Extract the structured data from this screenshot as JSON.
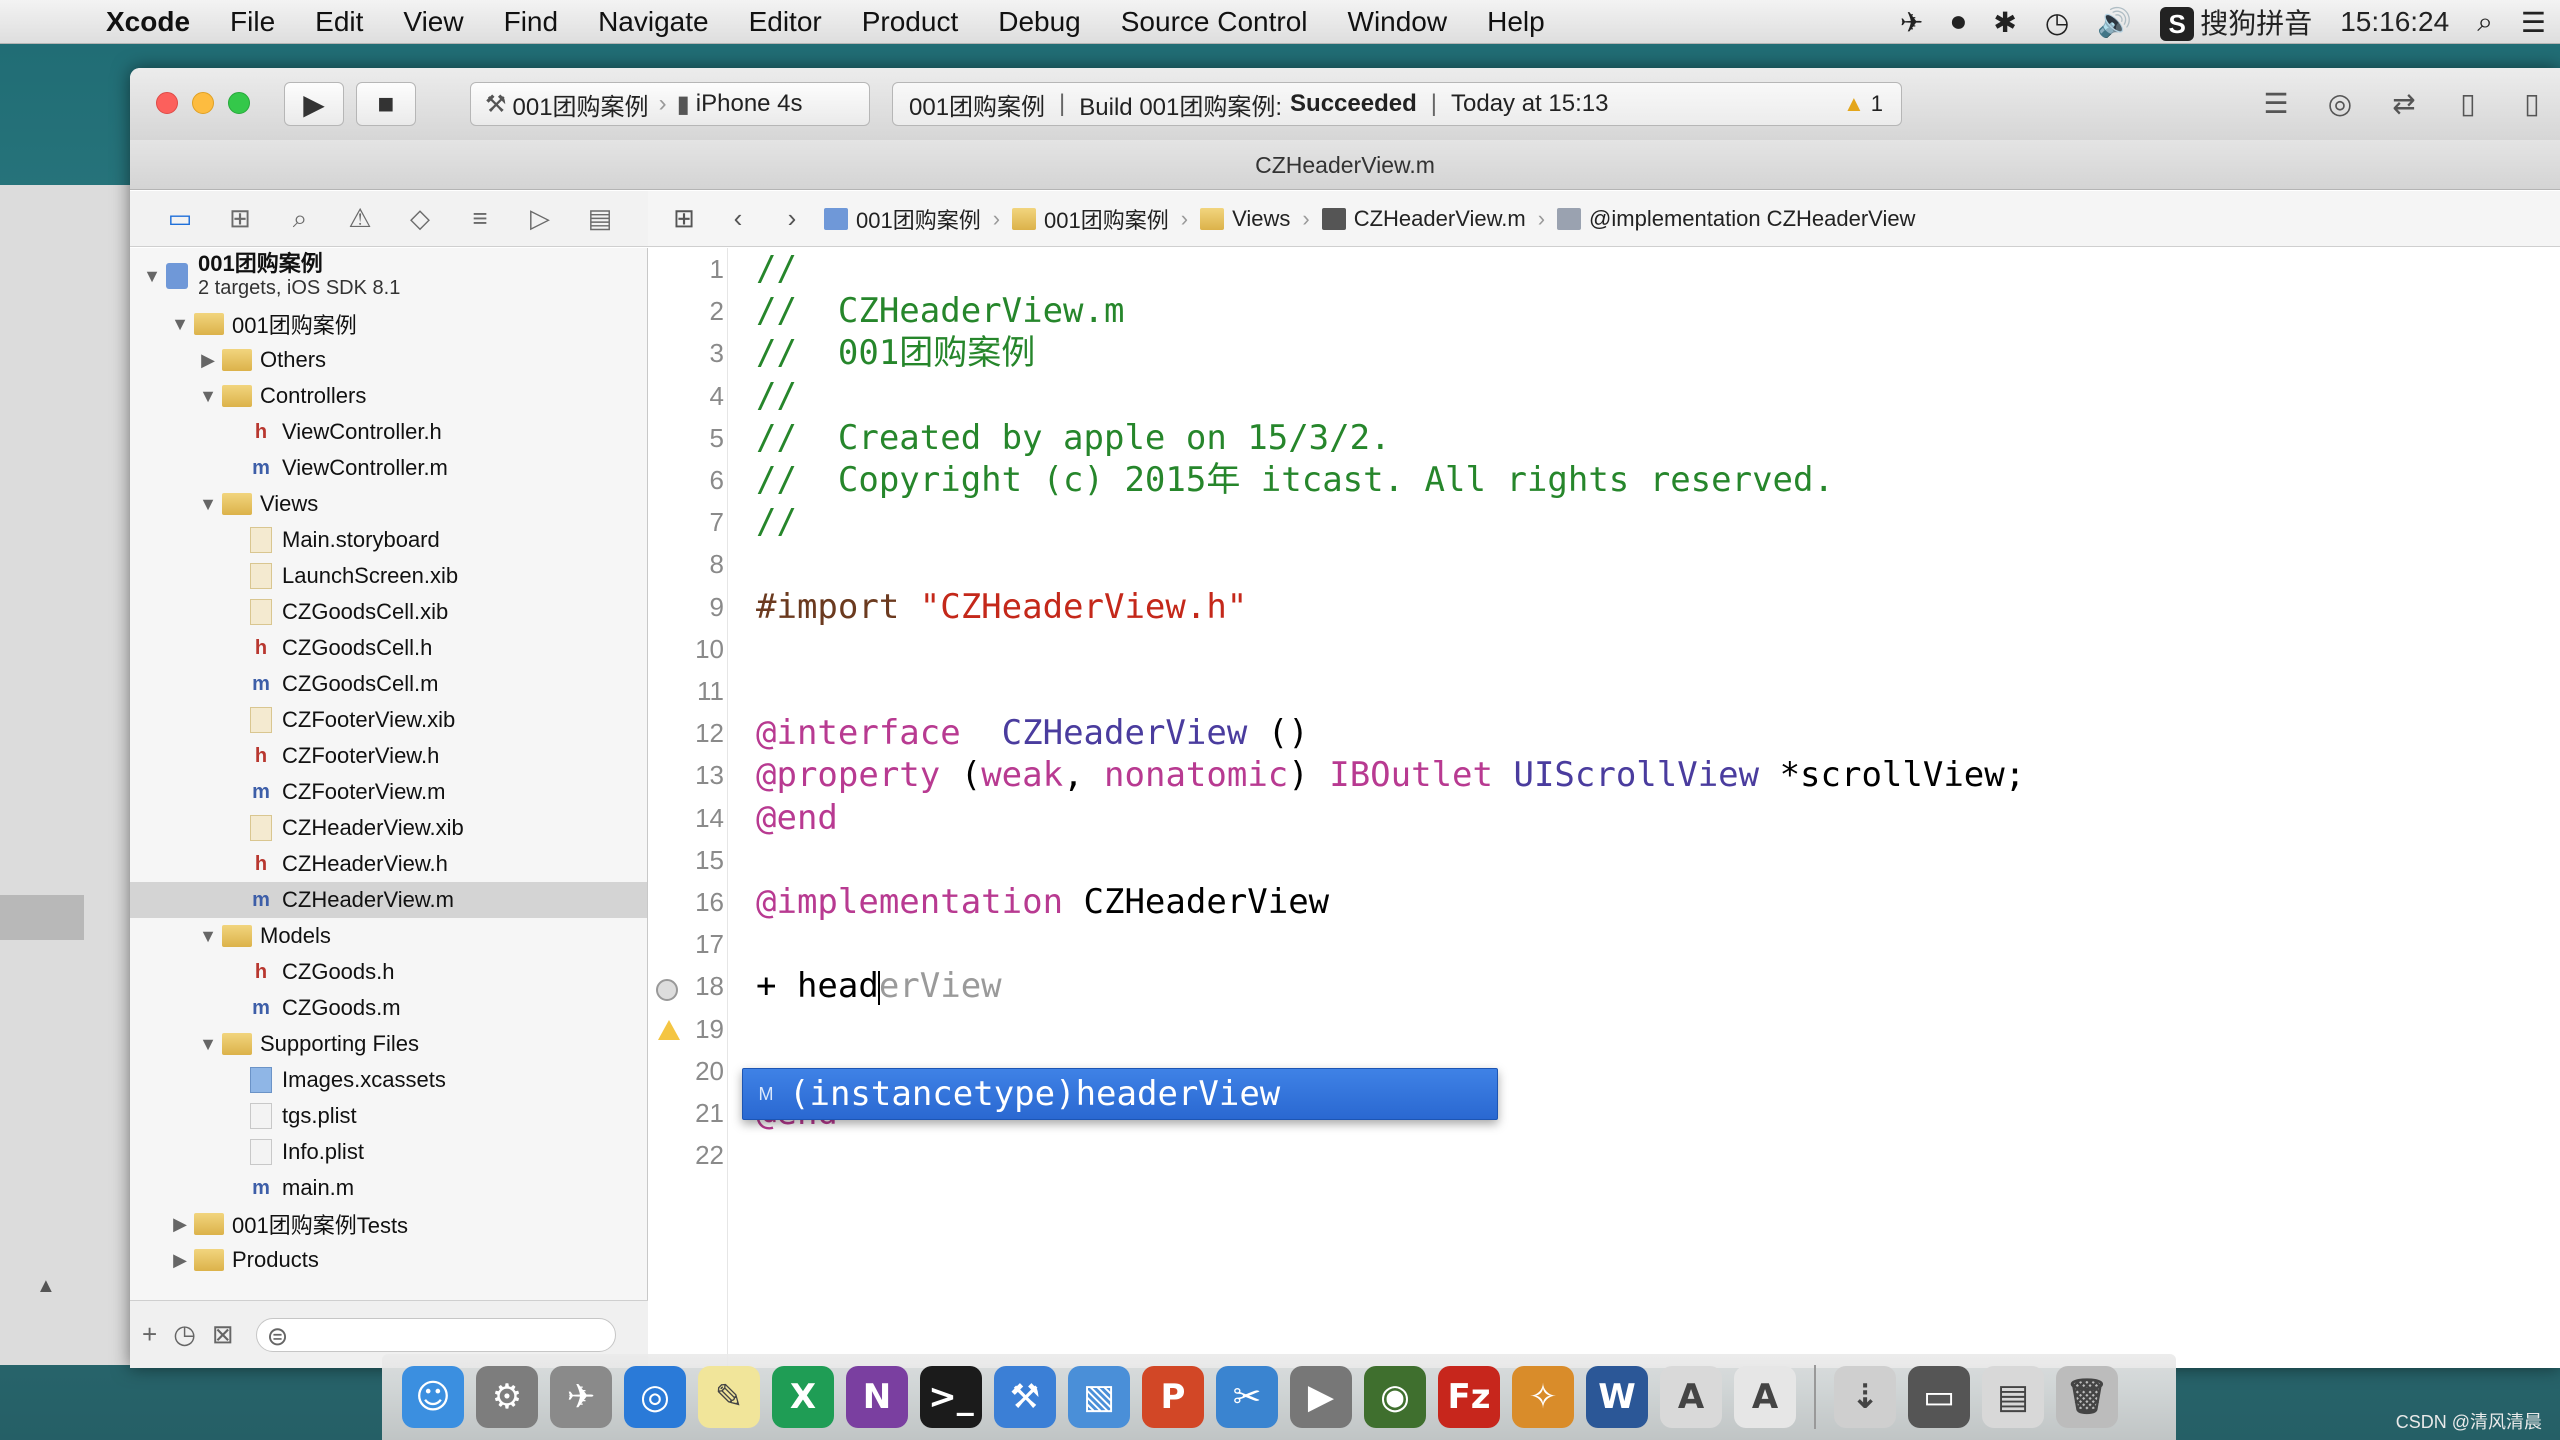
{
  "menubar": {
    "app": "Xcode",
    "items": [
      "File",
      "Edit",
      "View",
      "Find",
      "Navigate",
      "Editor",
      "Product",
      "Debug",
      "Source Control",
      "Window",
      "Help"
    ],
    "ime_label": "S",
    "ime_name": "搜狗拼音",
    "clock": "15:16:24"
  },
  "toolbar": {
    "scheme": "001团购案例",
    "device": "iPhone 4s",
    "status_project": "001团购案例",
    "status_build": "Build 001团购案例:",
    "status_result": "Succeeded",
    "status_time": "Today at 15:13",
    "warning_count": "1"
  },
  "window": {
    "title": "CZHeaderView.m"
  },
  "navigator": {
    "project_name": "001团购案例",
    "project_sub": "2 targets, iOS SDK 8.1",
    "rows": [
      {
        "label": "001团购案例",
        "indent": 1,
        "type": "folder",
        "disclosure": "open"
      },
      {
        "label": "Others",
        "indent": 2,
        "type": "folder",
        "disclosure": "closed"
      },
      {
        "label": "Controllers",
        "indent": 2,
        "type": "folder",
        "disclosure": "open"
      },
      {
        "label": "ViewController.h",
        "indent": 3,
        "type": "h"
      },
      {
        "label": "ViewController.m",
        "indent": 3,
        "type": "m"
      },
      {
        "label": "Views",
        "indent": 2,
        "type": "folder",
        "disclosure": "open"
      },
      {
        "label": "Main.storyboard",
        "indent": 3,
        "type": "doc"
      },
      {
        "label": "LaunchScreen.xib",
        "indent": 3,
        "type": "doc"
      },
      {
        "label": "CZGoodsCell.xib",
        "indent": 3,
        "type": "doc"
      },
      {
        "label": "CZGoodsCell.h",
        "indent": 3,
        "type": "h"
      },
      {
        "label": "CZGoodsCell.m",
        "indent": 3,
        "type": "m"
      },
      {
        "label": "CZFooterView.xib",
        "indent": 3,
        "type": "doc"
      },
      {
        "label": "CZFooterView.h",
        "indent": 3,
        "type": "h"
      },
      {
        "label": "CZFooterView.m",
        "indent": 3,
        "type": "m"
      },
      {
        "label": "CZHeaderView.xib",
        "indent": 3,
        "type": "doc"
      },
      {
        "label": "CZHeaderView.h",
        "indent": 3,
        "type": "h"
      },
      {
        "label": "CZHeaderView.m",
        "indent": 3,
        "type": "m",
        "selected": true
      },
      {
        "label": "Models",
        "indent": 2,
        "type": "folder",
        "disclosure": "open"
      },
      {
        "label": "CZGoods.h",
        "indent": 3,
        "type": "h"
      },
      {
        "label": "CZGoods.m",
        "indent": 3,
        "type": "m"
      },
      {
        "label": "Supporting Files",
        "indent": 2,
        "type": "folder",
        "disclosure": "open"
      },
      {
        "label": "Images.xcassets",
        "indent": 3,
        "type": "asset"
      },
      {
        "label": "tgs.plist",
        "indent": 3,
        "type": "plist"
      },
      {
        "label": "Info.plist",
        "indent": 3,
        "type": "plist"
      },
      {
        "label": "main.m",
        "indent": 3,
        "type": "m"
      },
      {
        "label": "001团购案例Tests",
        "indent": 1,
        "type": "folder",
        "disclosure": "closed"
      },
      {
        "label": "Products",
        "indent": 1,
        "type": "folder",
        "disclosure": "closed"
      }
    ]
  },
  "jumpbar": {
    "crumbs": [
      {
        "label": "001团购案例",
        "icon": "proj"
      },
      {
        "label": "001团购案例",
        "icon": "fold"
      },
      {
        "label": "Views",
        "icon": "fold"
      },
      {
        "label": "CZHeaderView.m",
        "icon": "m"
      },
      {
        "label": "@implementation CZHeaderView",
        "icon": "c"
      }
    ]
  },
  "editor": {
    "lines": [
      {
        "n": "1",
        "segs": [
          [
            "c-com",
            "//"
          ]
        ]
      },
      {
        "n": "2",
        "segs": [
          [
            "c-com",
            "//  CZHeaderView.m"
          ]
        ]
      },
      {
        "n": "3",
        "segs": [
          [
            "c-com",
            "//  001团购案例"
          ]
        ]
      },
      {
        "n": "4",
        "segs": [
          [
            "c-com",
            "//"
          ]
        ]
      },
      {
        "n": "5",
        "segs": [
          [
            "c-com",
            "//  Created by apple on 15/3/2."
          ]
        ]
      },
      {
        "n": "6",
        "segs": [
          [
            "c-com",
            "//  Copyright (c) 2015年 itcast. All rights reserved."
          ]
        ]
      },
      {
        "n": "7",
        "segs": [
          [
            "c-com",
            "//"
          ]
        ]
      },
      {
        "n": "8",
        "segs": []
      },
      {
        "n": "9",
        "segs": [
          [
            "c-pp",
            "#import "
          ],
          [
            "c-str",
            "\"CZHeaderView.h\""
          ]
        ]
      },
      {
        "n": "10",
        "segs": []
      },
      {
        "n": "11",
        "segs": []
      },
      {
        "n": "12",
        "segs": [
          [
            "c-kw",
            "@interface"
          ],
          [
            "",
            "  "
          ],
          [
            "c-cls",
            "CZHeaderView"
          ],
          [
            "",
            " ()"
          ]
        ]
      },
      {
        "n": "13",
        "segs": [
          [
            "c-kw",
            "@property"
          ],
          [
            "",
            " ("
          ],
          [
            "c-kw",
            "weak"
          ],
          [
            "",
            ", "
          ],
          [
            "c-kw",
            "nonatomic"
          ],
          [
            "",
            ") "
          ],
          [
            "c-kw",
            "IBOutlet"
          ],
          [
            "",
            " "
          ],
          [
            "c-cls",
            "UIScrollView"
          ],
          [
            "",
            " *scrollView;"
          ]
        ]
      },
      {
        "n": "14",
        "segs": [
          [
            "c-kw",
            "@end"
          ]
        ]
      },
      {
        "n": "15",
        "segs": []
      },
      {
        "n": "16",
        "segs": [
          [
            "c-kw",
            "@implementation"
          ],
          [
            "",
            " CZHeaderView"
          ]
        ]
      },
      {
        "n": "17",
        "segs": []
      },
      {
        "n": "18",
        "segs": [
          [
            "",
            "+ head"
          ],
          [
            "caret",
            ""
          ],
          [
            "c-ghost",
            "erView"
          ]
        ]
      },
      {
        "n": "19",
        "segs": []
      },
      {
        "n": "20",
        "segs": []
      },
      {
        "n": "21",
        "segs": [
          [
            "c-kw",
            "@end"
          ]
        ]
      },
      {
        "n": "22",
        "segs": []
      }
    ],
    "completion": {
      "kind": "M",
      "text": "(instancetype)headerView"
    }
  },
  "dock": {
    "apps": [
      {
        "name": "finder",
        "glyph": "☺",
        "color": "#3b8fe0"
      },
      {
        "name": "system-preferences",
        "glyph": "⚙",
        "color": "#7d7d7d"
      },
      {
        "name": "launchpad",
        "glyph": "✈",
        "color": "#8a8a8a"
      },
      {
        "name": "safari",
        "glyph": "◎",
        "color": "#2a7ad8"
      },
      {
        "name": "notes",
        "glyph": "✎",
        "color": "#f1e59a"
      },
      {
        "name": "excel",
        "glyph": "X",
        "color": "#1f9d55"
      },
      {
        "name": "onenote",
        "glyph": "N",
        "color": "#7a3fa0"
      },
      {
        "name": "terminal",
        "glyph": ">_",
        "color": "#1b1b1b"
      },
      {
        "name": "xcode",
        "glyph": "⚒",
        "color": "#3b7fd6"
      },
      {
        "name": "preview",
        "glyph": "▧",
        "color": "#4a8fd8"
      },
      {
        "name": "powerpoint",
        "glyph": "P",
        "color": "#d24726"
      },
      {
        "name": "tool-scissors",
        "glyph": "✂",
        "color": "#3a84d0"
      },
      {
        "name": "media-clapper",
        "glyph": "▶",
        "color": "#777777"
      },
      {
        "name": "globe-app",
        "glyph": "◉",
        "color": "#3f6f2e"
      },
      {
        "name": "filezilla",
        "glyph": "Fz",
        "color": "#c7261c"
      },
      {
        "name": "brush-app",
        "glyph": "✧",
        "color": "#d98c2a"
      },
      {
        "name": "word",
        "glyph": "W",
        "color": "#2b5797"
      },
      {
        "name": "script-editor",
        "glyph": "A",
        "color": "#d9d9d9"
      },
      {
        "name": "text-editor",
        "glyph": "A",
        "color": "#e6e6e6"
      }
    ],
    "extras": [
      {
        "name": "downloads-stack",
        "glyph": "⇣",
        "color": "#cfcfcf"
      },
      {
        "name": "desktop-stack",
        "glyph": "▭",
        "color": "#555555"
      },
      {
        "name": "documents-stack",
        "glyph": "▤",
        "color": "#d8d8d8"
      },
      {
        "name": "trash",
        "glyph": "🗑",
        "color": "#bcbcbc"
      }
    ]
  },
  "watermark": "CSDN @清风清晨"
}
